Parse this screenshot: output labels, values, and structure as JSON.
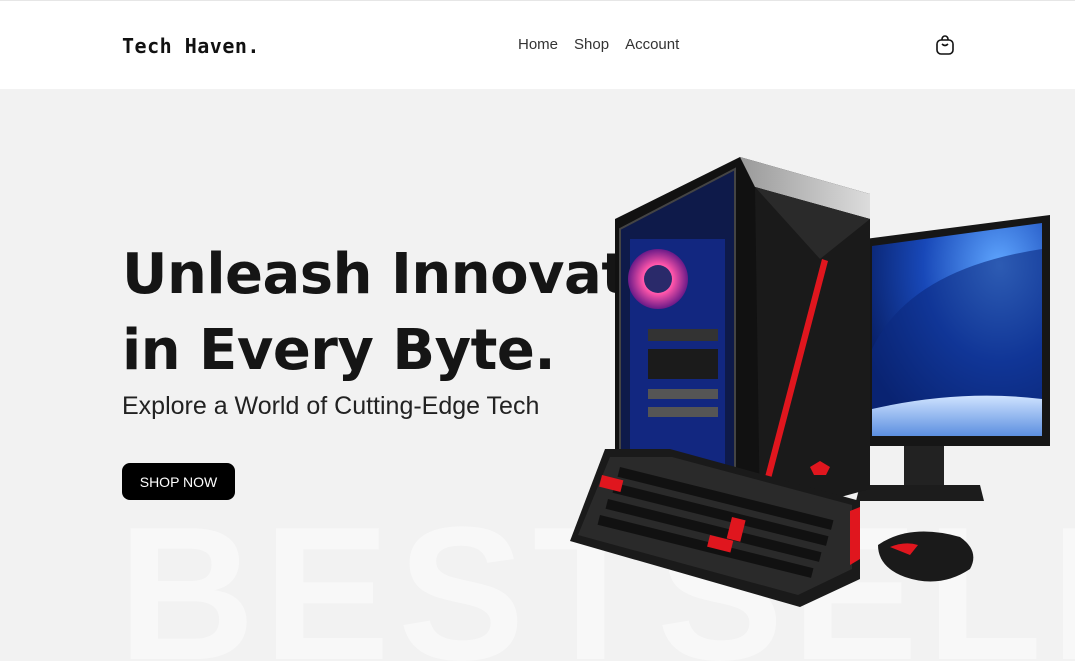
{
  "header": {
    "logo": "Tech Haven.",
    "nav": [
      "Home",
      "Shop",
      "Account"
    ],
    "cart_icon": "shopping-bag-icon"
  },
  "hero": {
    "headline_line1": "Unleash Innovation",
    "headline_line2": "in Every Byte.",
    "subheadline": "Explore a World of Cutting-Edge Tech",
    "cta_label": "SHOP NOW",
    "watermark": "BESTSELLER",
    "image_subject": "gaming PC tower with monitor, keyboard and mouse"
  },
  "colors": {
    "hero_background": "#f2f2f2",
    "cta_background": "#000000",
    "accent_red": "#e0161e"
  }
}
